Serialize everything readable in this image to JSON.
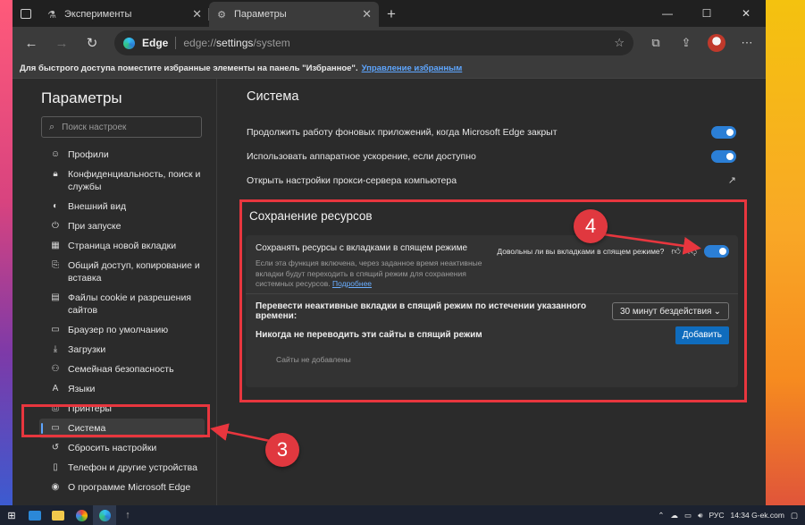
{
  "browser": {
    "tabs": [
      {
        "label": "Эксперименты",
        "active": false
      },
      {
        "label": "Параметры",
        "active": true
      }
    ],
    "address": {
      "brand": "Edge",
      "url_prefix": "edge://",
      "url_main": "settings",
      "url_suffix": "/system"
    },
    "favorites_bar": {
      "message": "Для быстрого доступа поместите избранные элементы на панель \"Избранное\".",
      "link": "Управление избранным"
    }
  },
  "sidebar": {
    "title": "Параметры",
    "search_placeholder": "Поиск настроек",
    "items": [
      {
        "label": "Профили",
        "icon": "person-icon"
      },
      {
        "label": "Конфиденциальность, поиск и службы",
        "icon": "lock-icon"
      },
      {
        "label": "Внешний вид",
        "icon": "appearance-icon"
      },
      {
        "label": "При запуске",
        "icon": "power-icon"
      },
      {
        "label": "Страница новой вкладки",
        "icon": "grid-icon"
      },
      {
        "label": "Общий доступ, копирование и вставка",
        "icon": "share-icon"
      },
      {
        "label": "Файлы cookie и разрешения сайтов",
        "icon": "cookie-icon"
      },
      {
        "label": "Браузер по умолчанию",
        "icon": "browser-icon"
      },
      {
        "label": "Загрузки",
        "icon": "download-icon"
      },
      {
        "label": "Семейная безопасность",
        "icon": "family-icon"
      },
      {
        "label": "Языки",
        "icon": "language-icon"
      },
      {
        "label": "Принтеры",
        "icon": "printer-icon"
      },
      {
        "label": "Система",
        "icon": "laptop-icon",
        "selected": true
      },
      {
        "label": "Сбросить настройки",
        "icon": "reset-icon"
      },
      {
        "label": "Телефон и другие устройства",
        "icon": "phone-icon"
      },
      {
        "label": "О программе Microsoft Edge",
        "icon": "edge-icon"
      }
    ]
  },
  "main": {
    "title": "Система",
    "settings": [
      {
        "label": "Продолжить работу фоновых приложений, когда Microsoft Edge закрыт",
        "control": "toggle",
        "on": true
      },
      {
        "label": "Использовать аппаратное ускорение, если доступно",
        "control": "toggle",
        "on": true
      },
      {
        "label": "Открыть настройки прокси-сервера компьютера",
        "control": "external-link"
      }
    ],
    "resources": {
      "title": "Сохранение ресурсов",
      "sleep_title": "Сохранять ресурсы с вкладками в спящем режиме",
      "sleep_desc": "Если эта функция включена, через заданное время неактивные вкладки будут переходить в спящий режим для сохранения системных ресурсов.",
      "sleep_link": "Подробнее",
      "feedback_question": "Довольны ли вы вкладками в спящем режиме?",
      "sleep_on": true,
      "inactive_label": "Перевести неактивные вкладки в спящий режим по истечении указанного времени:",
      "inactive_value": "30 минут бездействия",
      "never_label": "Никогда не переводить эти сайты в спящий режим",
      "add_button": "Добавить",
      "empty_note": "Сайты не добавлены"
    }
  },
  "annotations": {
    "badge_system": "3",
    "badge_toggle": "4",
    "color": "#e8363e"
  },
  "taskbar": {
    "lang": "РУС",
    "time": "14:34",
    "site": "G-ek.com"
  }
}
